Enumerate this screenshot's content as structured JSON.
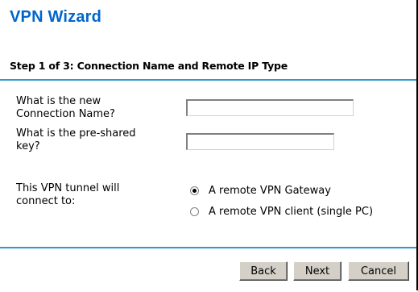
{
  "wizard": {
    "title": "VPN Wizard",
    "step_title": "Step 1 of 3: Connection Name and Remote IP Type"
  },
  "form": {
    "connection_name": {
      "label_line1": "What is the new",
      "label_line2": "Connection Name?",
      "value": ""
    },
    "preshared_key": {
      "label_line1": "What is the pre-shared",
      "label_line2": "key?",
      "value": ""
    },
    "tunnel": {
      "label_line1": "This VPN tunnel will",
      "label_line2": "connect to:",
      "options": [
        {
          "label": "A remote VPN Gateway",
          "selected": true
        },
        {
          "label": "A remote VPN client (single PC)",
          "selected": false
        }
      ]
    }
  },
  "buttons": {
    "back": "Back",
    "next": "Next",
    "cancel": "Cancel"
  },
  "colors": {
    "title": "#0066cc",
    "rule": "#3399cc",
    "button_face": "#d4d0c8"
  }
}
